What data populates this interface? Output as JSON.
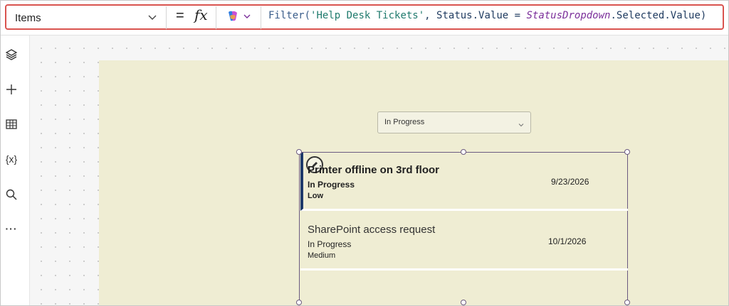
{
  "formula_bar": {
    "property": "Items",
    "equals": "=",
    "fx": "fx",
    "formula": {
      "fn": "Filter(",
      "source": "'Help Desk Tickets'",
      "mid": ", Status.Value = ",
      "control": "StatusDropdown",
      "tail": ".Selected.Value)"
    }
  },
  "rail": {
    "icons": [
      "layers-icon",
      "plus-icon",
      "table-icon",
      "variables-icon",
      "search-icon",
      "more-icon"
    ],
    "variables_glyph": "{x}",
    "more_glyph": "···"
  },
  "canvas": {
    "dropdown": {
      "value": "In Progress"
    },
    "gallery": {
      "items": [
        {
          "title": "Printer offline on 3rd floor",
          "status": "In Progress",
          "priority": "Low",
          "date": "9/23/2026"
        },
        {
          "title": "SharePoint access request",
          "status": "In Progress",
          "priority": "Medium",
          "date": "10/1/2026"
        }
      ]
    }
  },
  "colors": {
    "screen_bg": "#efedd3",
    "selection": "#6b5a80",
    "accent": "#1e3a6b",
    "formula_highlight": "#d9534f"
  }
}
